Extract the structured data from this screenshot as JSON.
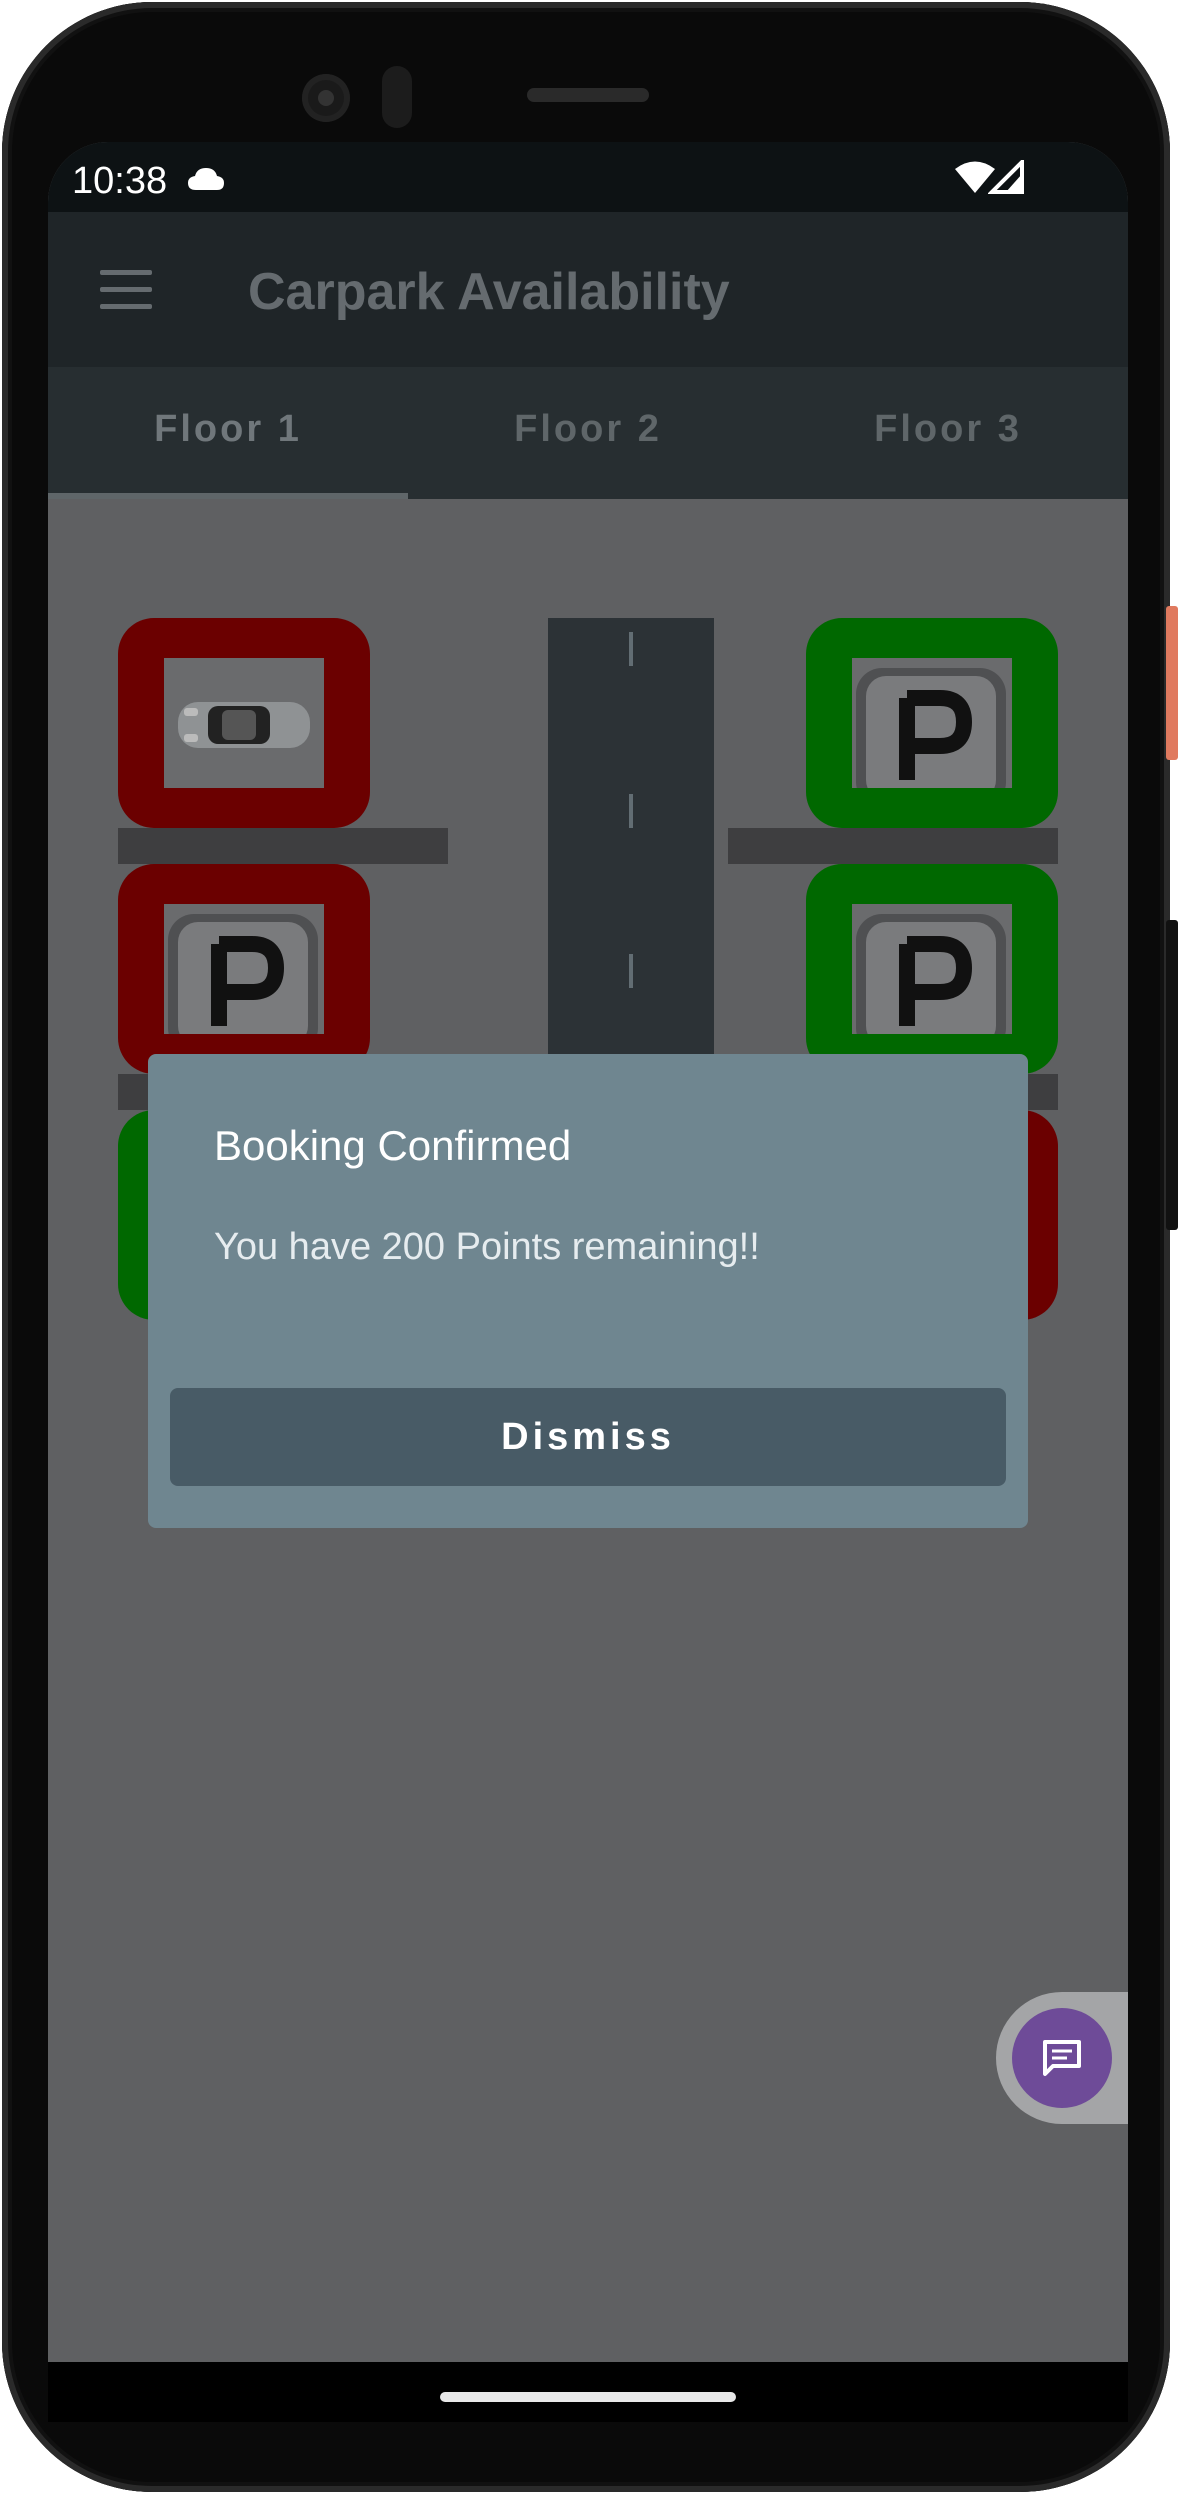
{
  "status_bar": {
    "time": "10:38"
  },
  "app_bar": {
    "title": "Carpark Availability"
  },
  "tabs": [
    {
      "label": "Floor 1",
      "selected": true
    },
    {
      "label": "Floor 2",
      "selected": false
    },
    {
      "label": "Floor 3",
      "selected": false
    }
  ],
  "parking_spots": [
    {
      "id": "left-1",
      "status": "occupied",
      "content": "car"
    },
    {
      "id": "left-2",
      "status": "occupied",
      "content": "parking-sign"
    },
    {
      "id": "left-3",
      "status": "free",
      "content": "parking-sign"
    },
    {
      "id": "right-1",
      "status": "free",
      "content": "parking-sign"
    },
    {
      "id": "right-2",
      "status": "free",
      "content": "parking-sign"
    },
    {
      "id": "right-3",
      "status": "occupied",
      "content": "parking-sign"
    }
  ],
  "dialog": {
    "title": "Booking Confirmed",
    "message": "You have 200 Points remaining!!",
    "dismiss_label": "Dismiss"
  },
  "colors": {
    "occupied": "#6b0000",
    "free": "#006800",
    "dialog_bg": "#6f8690",
    "dialog_button": "#485b66",
    "fab": "#6e4b98"
  },
  "icons": {
    "menu": "menu-icon",
    "chat": "chat-icon",
    "wifi": "wifi-icon",
    "cloud": "cloud-icon",
    "signal": "signal-icon"
  }
}
